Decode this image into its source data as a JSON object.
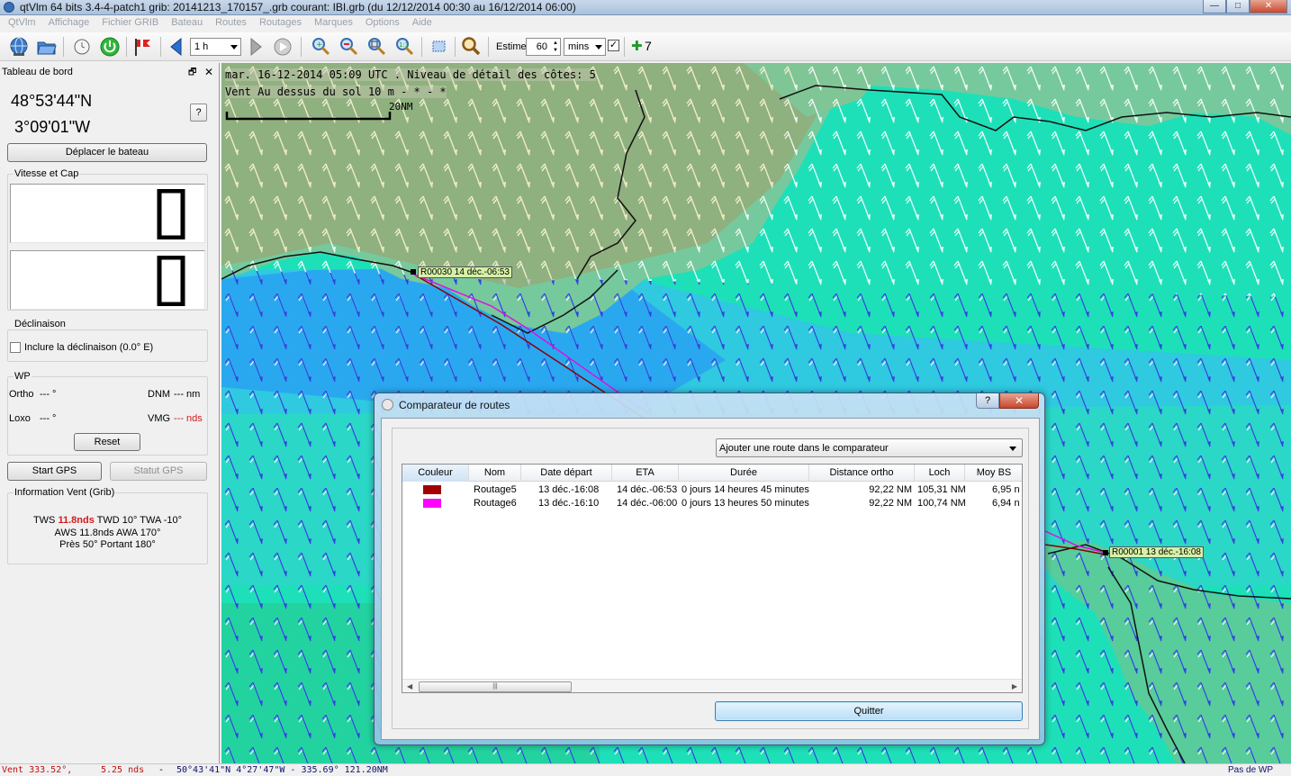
{
  "window": {
    "title": "qtVlm 64 bits 3.4-4-patch1 grib: 20141213_170157_.grb courant: IBI.grb (du 12/12/2014 00:30 au 16/12/2014 06:00)",
    "minimize": "—",
    "maximize": "□",
    "close": "✕"
  },
  "menu": [
    "QtVlm",
    "Affichage",
    "Fichier GRIB",
    "Bateau",
    "Routes",
    "Routages",
    "Marques",
    "Options",
    "Aide"
  ],
  "toolbar": {
    "step_value": "1 h",
    "estime_label": "Estime",
    "estime_value": "60",
    "estime_unit": "mins",
    "add_label": "7"
  },
  "dashboard": {
    "title": "Tableau de bord",
    "lat": "48°53'44\"N",
    "lon": "3°09'01\"W",
    "help_label": "?",
    "move_boat_button": "Déplacer le bateau",
    "speed_group_label": "Vitesse et Cap",
    "speed_value": "0",
    "heading_value": "0",
    "declinaison_label": "Déclinaison",
    "declinaison_checkbox": "Inclure la déclinaison (0.0° E)",
    "wp_label": "WP",
    "ortho_label": "Ortho",
    "ortho_value": "--- °",
    "dnm_label": "DNM",
    "dnm_value": "--- nm",
    "loxo_label": "Loxo",
    "loxo_value": "--- °",
    "vmg_label": "VMG",
    "vmg_value": "--- nds",
    "reset_button": "Reset",
    "start_gps_button": "Start GPS",
    "status_gps_button": "Statut GPS",
    "wind_info_label": "Information Vent (Grib)",
    "wind_line1_pre": "TWS ",
    "wind_line1_tws": "11.8nds",
    "wind_line1_post": " TWD 10° TWA -10°",
    "wind_line2": "AWS 11.8nds AWA 170°",
    "wind_line3": "Près 50° Portant 180°"
  },
  "map": {
    "line1": "mar. 16-12-2014 05:09 UTC . Niveau de détail des côtes: 5",
    "line2": "Vent Au dessus du sol 10 m - * - *",
    "scale_label": "20NM",
    "waypoint_end": "R00030 14 déc.-06:53",
    "waypoint_start": "R00001 13 déc.-16:08"
  },
  "status": {
    "wind": "Vent 333.52°,",
    "speed": "5.25 nds",
    "sep": "-",
    "position": "50°43'41\"N  4°27'47\"W - 335.69°  121.20NM",
    "right": "Pas de WP"
  },
  "dialog": {
    "title": "Comparateur de routes",
    "help": "?",
    "close": "✕",
    "add_route_combo": "Ajouter une route dans le comparateur",
    "columns": [
      "Couleur",
      "Nom",
      "Date départ",
      "ETA",
      "Durée",
      "Distance ortho",
      "Loch",
      "Moy BS"
    ],
    "rows": [
      {
        "color": "#a00000",
        "name": "Routage5",
        "depart": "13 déc.-16:08",
        "eta": "14 déc.-06:53",
        "duree": "0 jours 14 heures 45 minutes",
        "ortho": "92,22 NM",
        "loch": "105,31 NM",
        "moy": "6,95 n"
      },
      {
        "color": "#ff00ff",
        "name": "Routage6",
        "depart": "13 déc.-16:10",
        "eta": "14 déc.-06:00",
        "duree": "0 jours 13 heures 50 minutes",
        "ortho": "92,22 NM",
        "loch": "100,74 NM",
        "moy": "6,94 n"
      }
    ],
    "quit_button": "Quitter"
  }
}
